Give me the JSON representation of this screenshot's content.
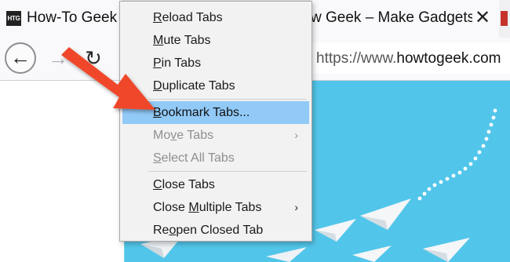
{
  "tabs": [
    {
      "title": "How-To Geek –",
      "favicon": "HTG",
      "active": true
    },
    {
      "title": "w Geek – Make Gadgets F",
      "close": "✕"
    },
    {
      "favicon": "partial-tab-icon"
    }
  ],
  "nav": {
    "back_icon": "←",
    "forward_icon": "→",
    "reload_icon": "↻",
    "url_prefix": "https://www.",
    "url_domain": "howtogeek.com"
  },
  "context_menu": {
    "items": [
      {
        "label": "Reload Tabs",
        "underline": "R"
      },
      {
        "label": "Mute Tabs",
        "underline": "M"
      },
      {
        "label": "Pin Tabs",
        "underline": "P"
      },
      {
        "label": "Duplicate Tabs",
        "underline": "D"
      },
      {
        "label": "Bookmark Tabs...",
        "underline": "B",
        "highlighted": true
      },
      {
        "label": "Move Tabs",
        "disabled": true,
        "submenu": "›"
      },
      {
        "label": "Select All Tabs",
        "disabled": true
      },
      {
        "label": "Close Tabs",
        "underline": "C"
      },
      {
        "label": "Close Multiple Tabs",
        "submenu": "›"
      },
      {
        "label": "Reopen Closed Tab"
      }
    ]
  },
  "colors": {
    "menu_highlight": "#91c9f7",
    "arrow": "#f0472a",
    "hero_background": "#52c6ea"
  }
}
